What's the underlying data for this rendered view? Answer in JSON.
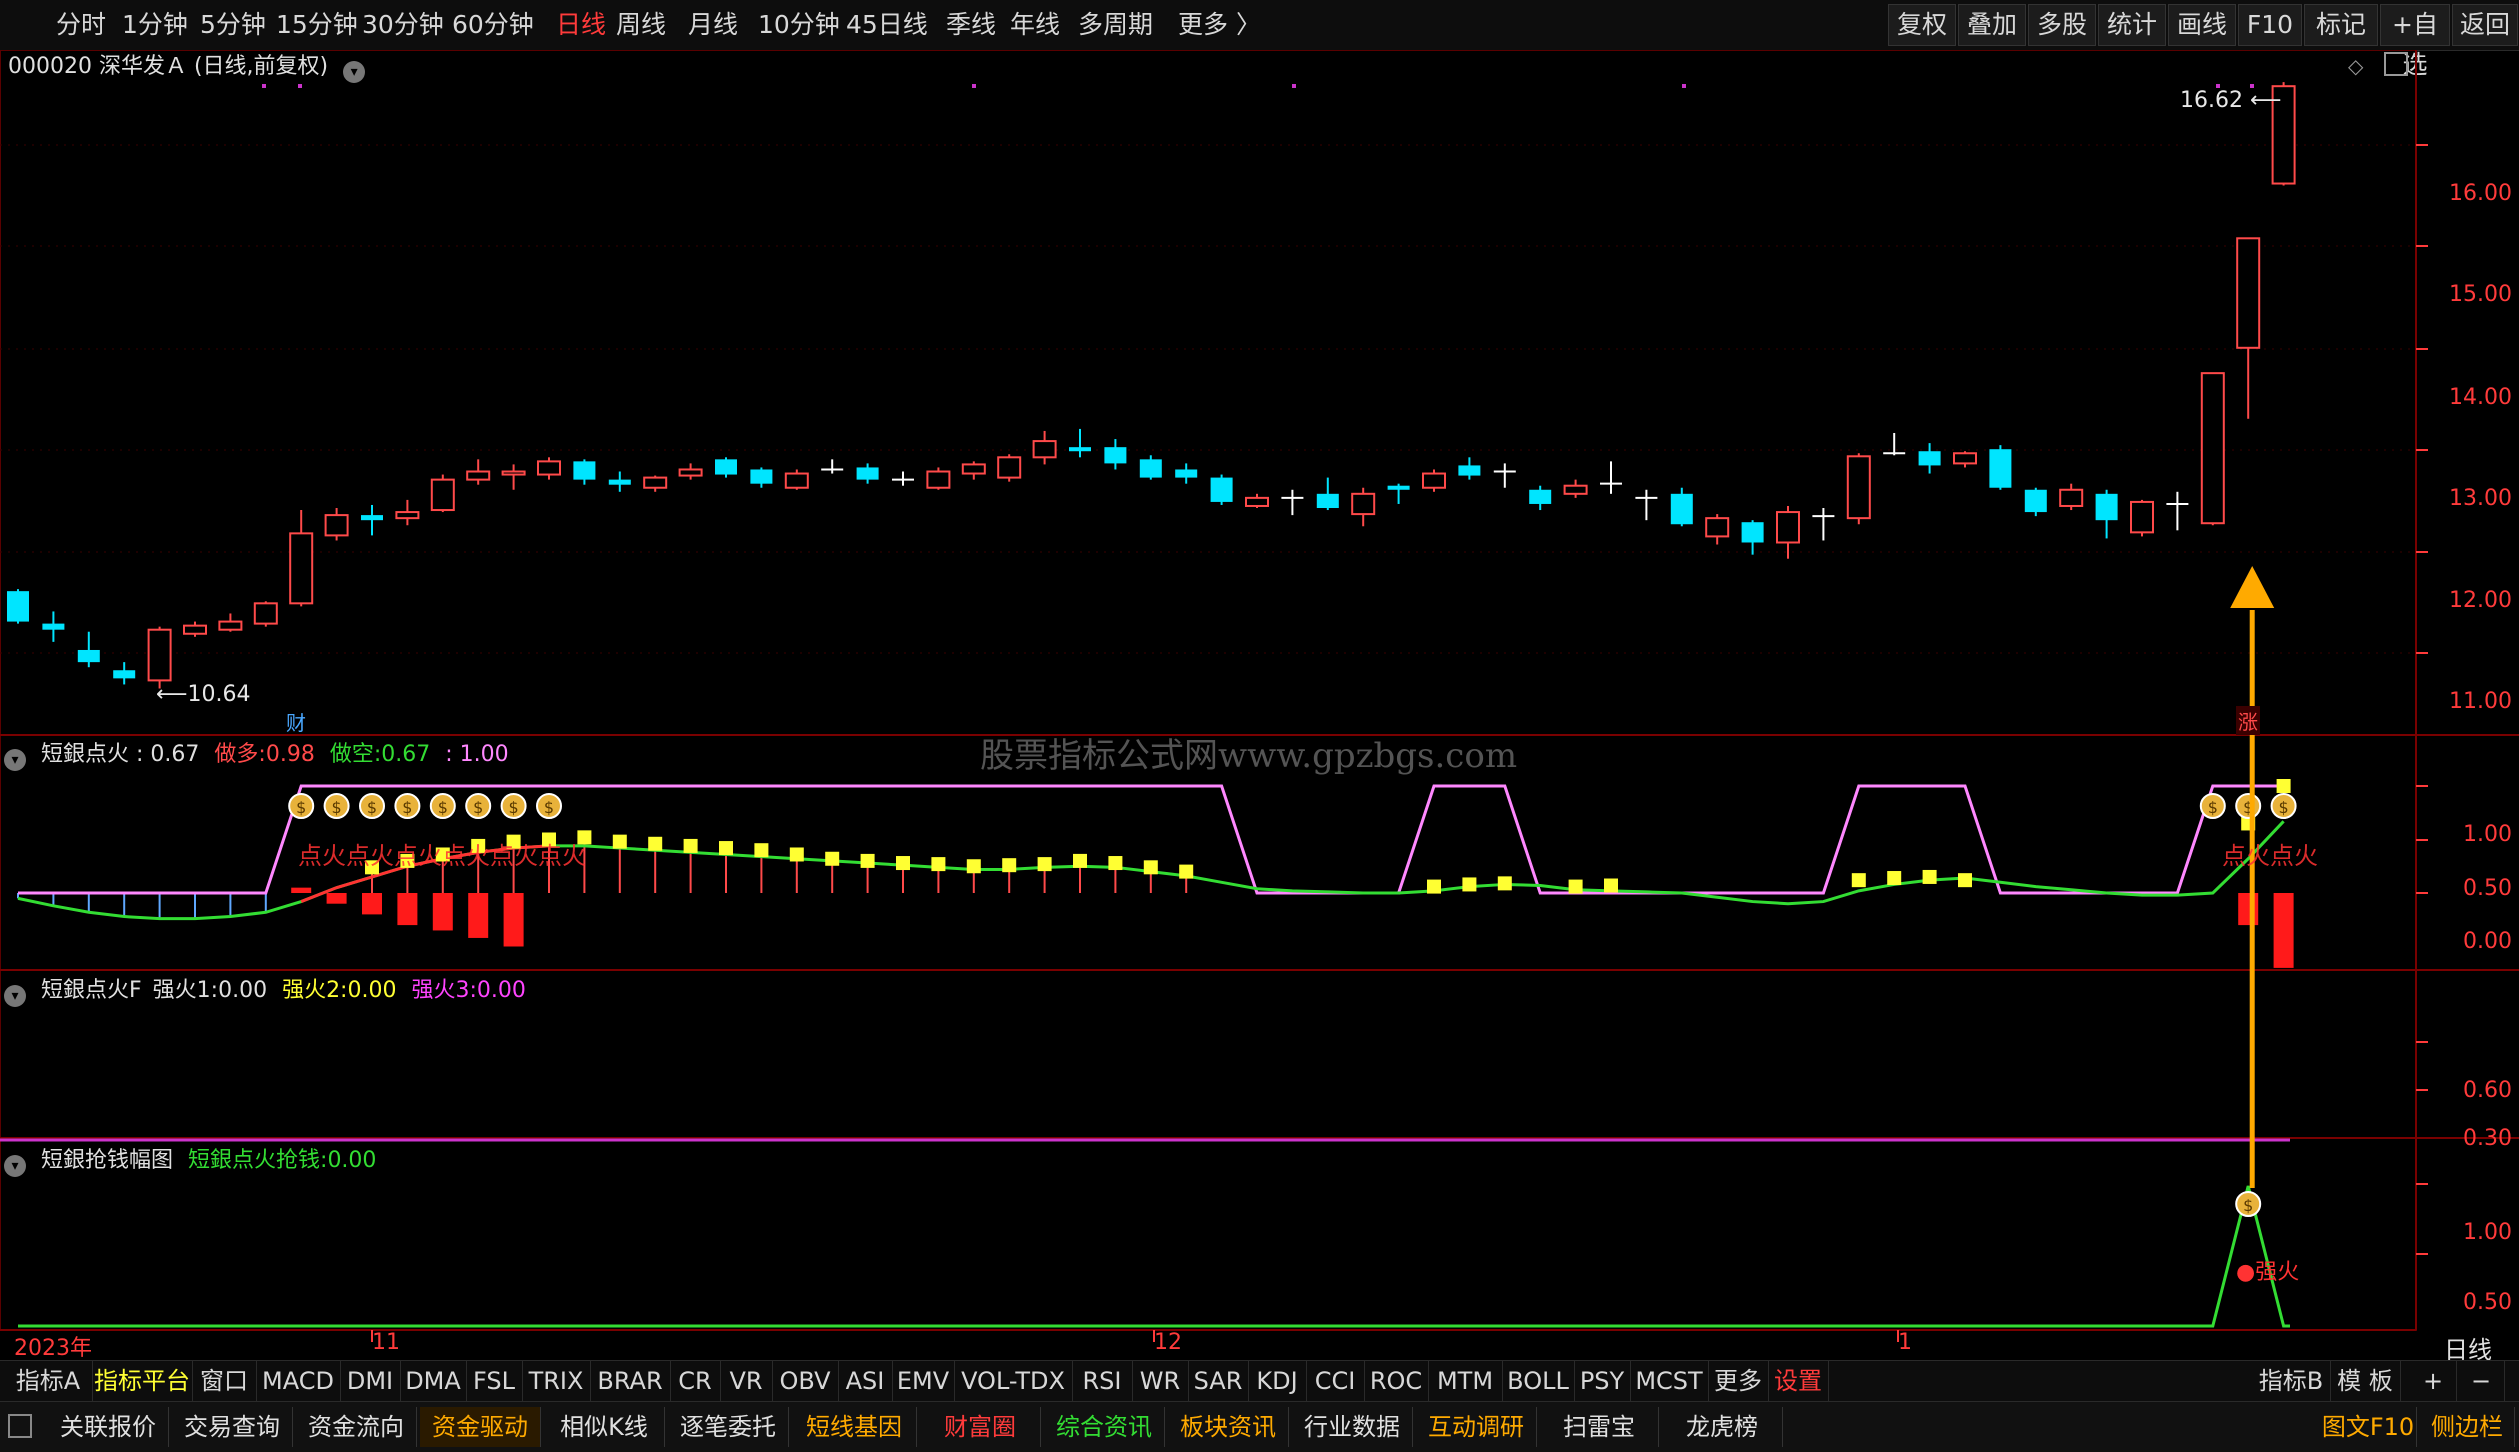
{
  "toolbar": {
    "periods": [
      "分时",
      "1分钟",
      "5分钟",
      "15分钟",
      "30分钟",
      "60分钟",
      "日线",
      "周线",
      "月线",
      "10分钟",
      "45日线",
      "季线",
      "年线",
      "多周期",
      "更多 〉"
    ],
    "active_period": "日线",
    "right_buttons": [
      "复权",
      "叠加",
      "多股",
      "统计",
      "画线",
      "F10",
      "标记",
      "+自选",
      "返回"
    ]
  },
  "stock": {
    "title": "000020 深华发Ａ (日线,前复权)",
    "high_label": "16.62",
    "low_label": "10.64",
    "fin_marker": "财",
    "zhang_marker": "涨"
  },
  "watermark": "股票指标公式网www.gpzbgs.com",
  "price_axis": [
    "16.00",
    "15.00",
    "14.00",
    "13.00",
    "12.00",
    "11.00"
  ],
  "pane2": {
    "name": "短銀点火",
    "value": ": 0.67",
    "zuoduo_label": "做多:",
    "zuoduo_value": "0.98",
    "zuokong_label": "做空:",
    "zuokong_value": "0.67",
    "extra": ": 1.00",
    "axis": [
      "1.00",
      "0.50",
      "0.00"
    ],
    "dianhuo_text": "点火点火点火点火点火点火",
    "dianhuo_text2": "点火点火"
  },
  "pane3": {
    "name": "短銀点火F",
    "q1_label": "强火1:",
    "q1_value": "0.00",
    "q2_label": "强火2:",
    "q2_value": "0.00",
    "q3_label": "强火3:",
    "q3_value": "0.00",
    "axis": [
      "0.60",
      "0.30"
    ]
  },
  "pane4": {
    "name": "短銀抢钱幅图",
    "sub_label": "短銀点火抢钱:",
    "sub_value": "0.00",
    "axis": [
      "1.00",
      "0.50"
    ],
    "qianghuo_text": "强火"
  },
  "time_axis": {
    "labels": [
      "2023年",
      "11",
      "12",
      "1"
    ],
    "right_label": "日线"
  },
  "indicator_bar": {
    "left": [
      "指标A",
      "指标平台",
      "窗口",
      "MACD",
      "DMI",
      "DMA",
      "FSL",
      "TRIX",
      "BRAR",
      "CR",
      "VR",
      "OBV",
      "ASI",
      "EMV",
      "VOL-TDX",
      "RSI",
      "WR",
      "SAR",
      "KDJ",
      "CCI",
      "ROC",
      "MTM",
      "BOLL",
      "PSY",
      "MCST",
      "更多",
      "设置"
    ],
    "right": [
      "指标B",
      "模 板",
      "+",
      "−"
    ]
  },
  "function_bar": {
    "items": [
      "关联报价",
      "交易查询",
      "资金流向",
      "资金驱动",
      "相似K线",
      "逐笔委托",
      "短线基因",
      "财富圈",
      "综合资讯",
      "板块资讯",
      "行业数据",
      "互动调研",
      "扫雷宝",
      "龙虎榜"
    ],
    "right": [
      "图文F10",
      "侧边栏"
    ]
  },
  "colors": {
    "up": "#ff4a4a",
    "down": "#00e5ff",
    "pink": "#ff88ff",
    "green": "#33dd33",
    "yellow": "#ffff33",
    "magenta": "#cc33cc",
    "gold": "#ffaa00",
    "axis_red": "#ff3b3b"
  },
  "candles": [
    {
      "o": 11.6,
      "c": 11.3,
      "h": 11.62,
      "l": 11.28
    },
    {
      "o": 11.28,
      "c": 11.22,
      "h": 11.4,
      "l": 11.1
    },
    {
      "o": 11.02,
      "c": 10.9,
      "h": 11.2,
      "l": 10.85
    },
    {
      "o": 10.82,
      "c": 10.74,
      "h": 10.9,
      "l": 10.68
    },
    {
      "o": 10.72,
      "c": 11.22,
      "h": 11.25,
      "l": 10.64
    },
    {
      "o": 11.18,
      "c": 11.26,
      "h": 11.3,
      "l": 11.15
    },
    {
      "o": 11.22,
      "c": 11.3,
      "h": 11.38,
      "l": 11.2
    },
    {
      "o": 11.28,
      "c": 11.48,
      "h": 11.5,
      "l": 11.25
    },
    {
      "o": 11.48,
      "c": 12.17,
      "h": 12.4,
      "l": 11.45
    },
    {
      "o": 12.15,
      "c": 12.35,
      "h": 12.42,
      "l": 12.1
    },
    {
      "o": 12.35,
      "c": 12.3,
      "h": 12.45,
      "l": 12.15
    },
    {
      "o": 12.32,
      "c": 12.38,
      "h": 12.5,
      "l": 12.25
    },
    {
      "o": 12.4,
      "c": 12.7,
      "h": 12.75,
      "l": 12.38
    },
    {
      "o": 12.7,
      "c": 12.78,
      "h": 12.9,
      "l": 12.65
    },
    {
      "o": 12.75,
      "c": 12.78,
      "h": 12.85,
      "l": 12.6
    },
    {
      "o": 12.75,
      "c": 12.88,
      "h": 12.92,
      "l": 12.7
    },
    {
      "o": 12.88,
      "c": 12.7,
      "h": 12.9,
      "l": 12.65
    },
    {
      "o": 12.7,
      "c": 12.65,
      "h": 12.78,
      "l": 12.58
    },
    {
      "o": 12.62,
      "c": 12.72,
      "h": 12.74,
      "l": 12.58
    },
    {
      "o": 12.74,
      "c": 12.8,
      "h": 12.86,
      "l": 12.7
    },
    {
      "o": 12.9,
      "c": 12.75,
      "h": 12.92,
      "l": 12.72
    },
    {
      "o": 12.8,
      "c": 12.66,
      "h": 12.82,
      "l": 12.62
    },
    {
      "o": 12.62,
      "c": 12.76,
      "h": 12.8,
      "l": 12.6
    },
    {
      "o": 12.8,
      "c": 12.81,
      "h": 12.9,
      "l": 12.76
    },
    {
      "o": 12.82,
      "c": 12.7,
      "h": 12.86,
      "l": 12.66
    },
    {
      "o": 12.7,
      "c": 12.69,
      "h": 12.78,
      "l": 12.64
    },
    {
      "o": 12.62,
      "c": 12.78,
      "h": 12.82,
      "l": 12.6
    },
    {
      "o": 12.76,
      "c": 12.85,
      "h": 12.88,
      "l": 12.7
    },
    {
      "o": 12.72,
      "c": 12.92,
      "h": 12.95,
      "l": 12.68
    },
    {
      "o": 12.92,
      "c": 13.08,
      "h": 13.18,
      "l": 12.85
    },
    {
      "o": 13.02,
      "c": 12.98,
      "h": 13.2,
      "l": 12.92
    },
    {
      "o": 13.02,
      "c": 12.86,
      "h": 13.1,
      "l": 12.8
    },
    {
      "o": 12.9,
      "c": 12.72,
      "h": 12.94,
      "l": 12.7
    },
    {
      "o": 12.8,
      "c": 12.72,
      "h": 12.86,
      "l": 12.66
    },
    {
      "o": 12.72,
      "c": 12.48,
      "h": 12.75,
      "l": 12.45
    },
    {
      "o": 12.44,
      "c": 12.52,
      "h": 12.56,
      "l": 12.42
    },
    {
      "o": 12.52,
      "c": 12.51,
      "h": 12.6,
      "l": 12.35
    },
    {
      "o": 12.56,
      "c": 12.42,
      "h": 12.72,
      "l": 12.4
    },
    {
      "o": 12.36,
      "c": 12.56,
      "h": 12.62,
      "l": 12.24
    },
    {
      "o": 12.64,
      "c": 12.6,
      "h": 12.66,
      "l": 12.46
    },
    {
      "o": 12.62,
      "c": 12.76,
      "h": 12.8,
      "l": 12.58
    },
    {
      "o": 12.84,
      "c": 12.74,
      "h": 12.92,
      "l": 12.7
    },
    {
      "o": 12.78,
      "c": 12.76,
      "h": 12.86,
      "l": 12.62
    },
    {
      "o": 12.6,
      "c": 12.46,
      "h": 12.64,
      "l": 12.4
    },
    {
      "o": 12.56,
      "c": 12.64,
      "h": 12.7,
      "l": 12.52
    },
    {
      "o": 12.66,
      "c": 12.65,
      "h": 12.88,
      "l": 12.56
    },
    {
      "o": 12.52,
      "c": 12.51,
      "h": 12.6,
      "l": 12.3
    },
    {
      "o": 12.56,
      "c": 12.26,
      "h": 12.62,
      "l": 12.24
    },
    {
      "o": 12.14,
      "c": 12.32,
      "h": 12.36,
      "l": 12.06
    },
    {
      "o": 12.28,
      "c": 12.08,
      "h": 12.3,
      "l": 11.96
    },
    {
      "o": 12.08,
      "c": 12.38,
      "h": 12.44,
      "l": 11.92
    },
    {
      "o": 12.34,
      "c": 12.33,
      "h": 12.42,
      "l": 12.1
    },
    {
      "o": 12.32,
      "c": 12.93,
      "h": 12.96,
      "l": 12.26
    },
    {
      "o": 12.96,
      "c": 12.98,
      "h": 13.16,
      "l": 12.94
    },
    {
      "o": 12.98,
      "c": 12.84,
      "h": 13.06,
      "l": 12.76
    },
    {
      "o": 12.86,
      "c": 12.96,
      "h": 12.98,
      "l": 12.82
    },
    {
      "o": 13.0,
      "c": 12.62,
      "h": 13.04,
      "l": 12.6
    },
    {
      "o": 12.6,
      "c": 12.38,
      "h": 12.62,
      "l": 12.34
    },
    {
      "o": 12.44,
      "c": 12.6,
      "h": 12.66,
      "l": 12.4
    },
    {
      "o": 12.56,
      "c": 12.3,
      "h": 12.6,
      "l": 12.12
    },
    {
      "o": 12.18,
      "c": 12.48,
      "h": 12.5,
      "l": 12.14
    },
    {
      "o": 12.46,
      "c": 12.45,
      "h": 12.58,
      "l": 12.2
    },
    {
      "o": 12.27,
      "c": 13.75,
      "h": 13.75,
      "l": 12.25
    },
    {
      "o": 14.0,
      "c": 15.08,
      "h": 15.08,
      "l": 13.3
    },
    {
      "o": 15.62,
      "c": 16.58,
      "h": 16.62,
      "l": 15.6
    }
  ],
  "dianhuo": {
    "pink_line": [
      0,
      0,
      0,
      0,
      0,
      0,
      0,
      0,
      1,
      1,
      1,
      1,
      1,
      1,
      1,
      1,
      1,
      1,
      1,
      1,
      1,
      1,
      1,
      1,
      1,
      1,
      1,
      1,
      1,
      1,
      1,
      1,
      1,
      1,
      1,
      0,
      0,
      0,
      0,
      0,
      1,
      1,
      1,
      0,
      0,
      0,
      0,
      0,
      0,
      0,
      0,
      0,
      1,
      1,
      1,
      1,
      0,
      0,
      0,
      0,
      0,
      0,
      1,
      1,
      1
    ],
    "green_line": [
      -0.05,
      -0.12,
      -0.18,
      -0.22,
      -0.24,
      -0.24,
      -0.22,
      -0.18,
      -0.08,
      0.05,
      0.15,
      0.25,
      0.32,
      0.38,
      0.42,
      0.44,
      0.44,
      0.42,
      0.4,
      0.38,
      0.36,
      0.34,
      0.32,
      0.3,
      0.28,
      0.26,
      0.24,
      0.22,
      0.22,
      0.24,
      0.25,
      0.24,
      0.2,
      0.16,
      0.1,
      0.04,
      0.02,
      0.01,
      0.0,
      0.0,
      0.02,
      0.06,
      0.08,
      0.07,
      0.03,
      0.02,
      0.01,
      0.0,
      -0.04,
      -0.08,
      -0.1,
      -0.08,
      0.02,
      0.08,
      0.12,
      0.14,
      0.1,
      0.06,
      0.03,
      0.0,
      -0.02,
      -0.02,
      0.0,
      0.32,
      0.67
    ],
    "yellow_dots": [
      null,
      null,
      null,
      null,
      null,
      null,
      null,
      null,
      null,
      null,
      0.24,
      0.3,
      0.36,
      0.44,
      0.48,
      0.5,
      0.52,
      0.48,
      0.46,
      0.44,
      0.42,
      0.4,
      0.36,
      0.32,
      0.3,
      0.28,
      0.27,
      0.25,
      0.26,
      0.27,
      0.3,
      0.28,
      0.24,
      0.2,
      null,
      null,
      null,
      null,
      null,
      null,
      0.06,
      0.08,
      0.09,
      null,
      0.06,
      0.07,
      null,
      null,
      null,
      null,
      null,
      null,
      0.12,
      0.14,
      0.15,
      0.12,
      null,
      null,
      null,
      null,
      null,
      null,
      null,
      0.65,
      1.0
    ],
    "red_bars": [
      0,
      0,
      0,
      0,
      0,
      0,
      0,
      0,
      0.05,
      -0.1,
      -0.2,
      -0.3,
      -0.35,
      -0.42,
      -0.5,
      0,
      0,
      0,
      0,
      0,
      0,
      0,
      0,
      0,
      0,
      0,
      0,
      0,
      0,
      0,
      0,
      0,
      0,
      0,
      0,
      0,
      0,
      0,
      0,
      0,
      0,
      0,
      0,
      0,
      0,
      0,
      0,
      0,
      0,
      0,
      0,
      0,
      0,
      0,
      0,
      0,
      0,
      0,
      0,
      0,
      0,
      0,
      0,
      -0.3,
      -0.7
    ]
  },
  "qiang": {
    "green_line": [
      0,
      0,
      0,
      0,
      0,
      0,
      0,
      0,
      0,
      0,
      0,
      0,
      0,
      0,
      0,
      0,
      0,
      0,
      0,
      0,
      0,
      0,
      0,
      0,
      0,
      0,
      0,
      0,
      0,
      0,
      0,
      0,
      0,
      0,
      0,
      0,
      0,
      0,
      0,
      0,
      0,
      0,
      0,
      0,
      0,
      0,
      0,
      0,
      0,
      0,
      0,
      0,
      0,
      0,
      0,
      0,
      0,
      0,
      0,
      0,
      0,
      0,
      0,
      1,
      0
    ]
  }
}
